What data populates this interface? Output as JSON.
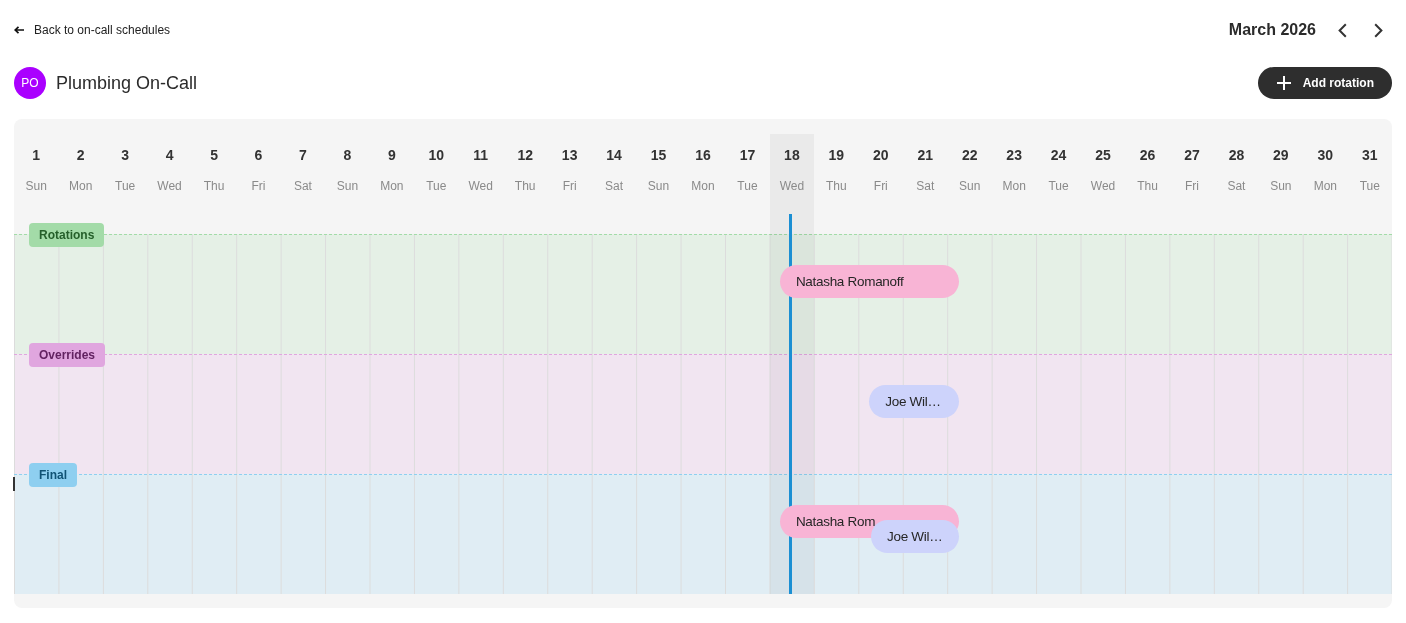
{
  "back_link": {
    "label": "Back to on-call schedules"
  },
  "month_nav": {
    "label": "March 2026"
  },
  "schedule": {
    "avatar": "PO",
    "title": "Plumbing On-Call"
  },
  "add_button": {
    "label": "Add rotation"
  },
  "days": [
    {
      "day": "1",
      "weekday": "Sun",
      "today": false
    },
    {
      "day": "2",
      "weekday": "Mon",
      "today": false
    },
    {
      "day": "3",
      "weekday": "Tue",
      "today": false
    },
    {
      "day": "4",
      "weekday": "Wed",
      "today": false
    },
    {
      "day": "5",
      "weekday": "Thu",
      "today": false
    },
    {
      "day": "6",
      "weekday": "Fri",
      "today": false
    },
    {
      "day": "7",
      "weekday": "Sat",
      "today": false
    },
    {
      "day": "8",
      "weekday": "Sun",
      "today": false
    },
    {
      "day": "9",
      "weekday": "Mon",
      "today": false
    },
    {
      "day": "10",
      "weekday": "Tue",
      "today": false
    },
    {
      "day": "11",
      "weekday": "Wed",
      "today": false
    },
    {
      "day": "12",
      "weekday": "Thu",
      "today": false
    },
    {
      "day": "13",
      "weekday": "Fri",
      "today": false
    },
    {
      "day": "14",
      "weekday": "Sat",
      "today": false
    },
    {
      "day": "15",
      "weekday": "Sun",
      "today": false
    },
    {
      "day": "16",
      "weekday": "Mon",
      "today": false
    },
    {
      "day": "17",
      "weekday": "Tue",
      "today": false
    },
    {
      "day": "18",
      "weekday": "Wed",
      "today": true
    },
    {
      "day": "19",
      "weekday": "Thu",
      "today": false
    },
    {
      "day": "20",
      "weekday": "Fri",
      "today": false
    },
    {
      "day": "21",
      "weekday": "Sat",
      "today": false
    },
    {
      "day": "22",
      "weekday": "Sun",
      "today": false
    },
    {
      "day": "23",
      "weekday": "Mon",
      "today": false
    },
    {
      "day": "24",
      "weekday": "Tue",
      "today": false
    },
    {
      "day": "25",
      "weekday": "Wed",
      "today": false
    },
    {
      "day": "26",
      "weekday": "Thu",
      "today": false
    },
    {
      "day": "27",
      "weekday": "Fri",
      "today": false
    },
    {
      "day": "28",
      "weekday": "Sat",
      "today": false
    },
    {
      "day": "29",
      "weekday": "Sun",
      "today": false
    },
    {
      "day": "30",
      "weekday": "Mon",
      "today": false
    },
    {
      "day": "31",
      "weekday": "Tue",
      "today": false
    }
  ],
  "bands": [
    {
      "label": "Rotations",
      "color": "#a3dba8",
      "shifts": [
        {
          "name": "Natasha Romanoff",
          "color": "#f8b4d5"
        }
      ]
    },
    {
      "label": "Overrides",
      "color": "#e0a6df",
      "shifts": [
        {
          "name": "Joe Wil…",
          "color": "#cdd3fb"
        }
      ]
    },
    {
      "label": "Final",
      "color": "#8ecff0",
      "shifts": [
        {
          "name": "Natasha Rom",
          "color": "#f8b4d5"
        },
        {
          "name": "Joe Wil…",
          "color": "#cdd3fb"
        }
      ]
    }
  ]
}
